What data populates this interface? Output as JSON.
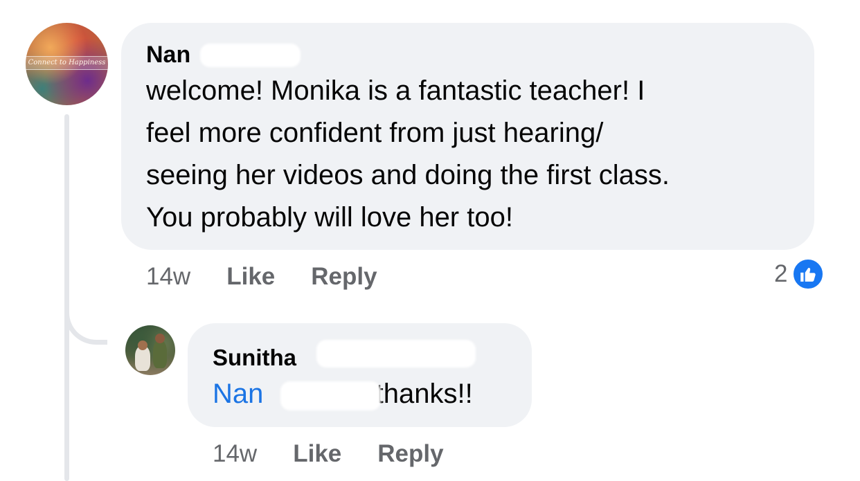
{
  "comment": {
    "author": "Nan",
    "avatar_caption": "Connect to Happiness",
    "text_lines": [
      "welcome! Monika is a fantastic teacher! I",
      "feel more confident from just hearing/",
      "seeing her videos and doing the first class.",
      "You probably will love her too!"
    ],
    "time": "14w",
    "like_label": "Like",
    "reply_label": "Reply",
    "reaction_count": "2",
    "reaction_icon": "thumbs-up-icon",
    "accent_color": "#1877f2"
  },
  "reply": {
    "author": "Sunitha",
    "mention": "Nan",
    "text": "thanks!!",
    "time": "14w",
    "like_label": "Like",
    "reply_label": "Reply",
    "mention_color": "#1b74e4"
  }
}
